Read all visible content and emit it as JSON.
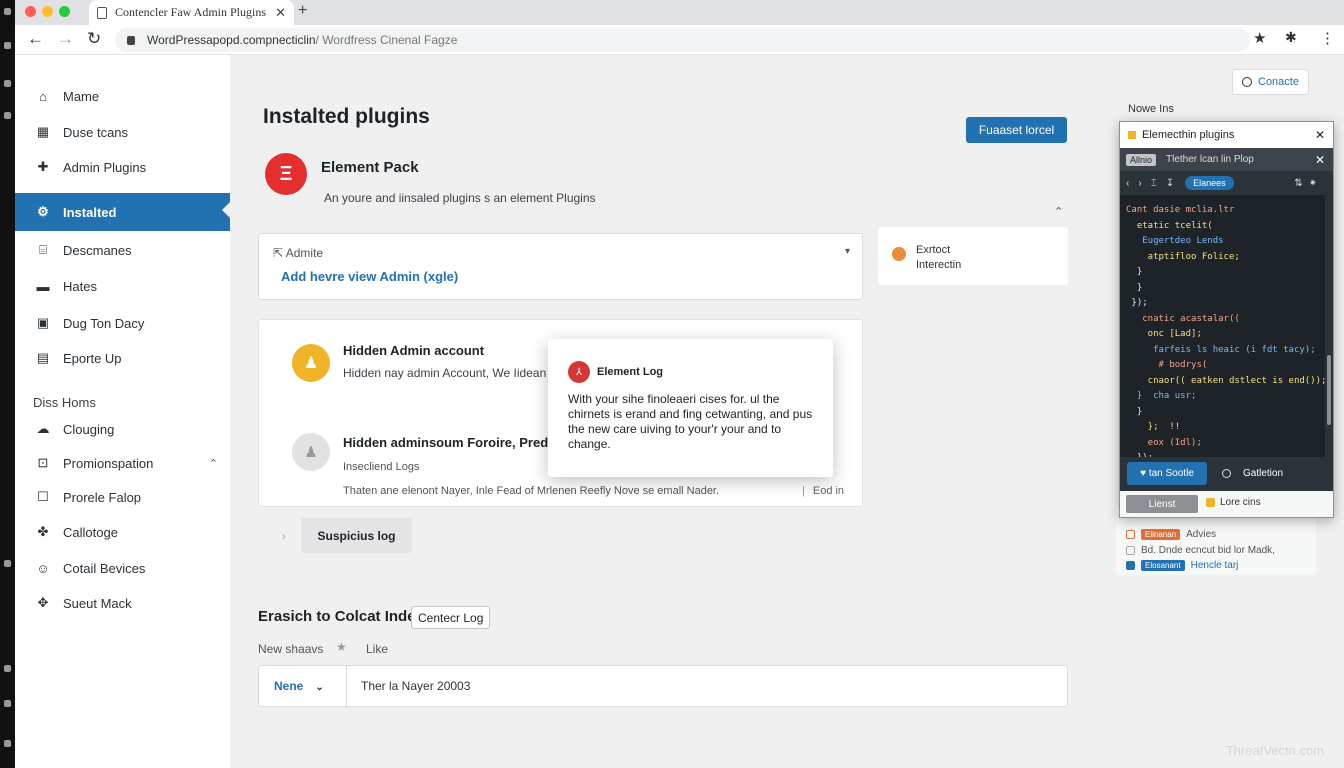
{
  "browser": {
    "tab_title": "Contencler Faw Admin Plugins",
    "tab_close": "✕",
    "new_tab": "+",
    "url_main": "WordPressapopd.compnecticlin",
    "url_rest": " / Wordfress Cinenal Fagze",
    "colors": {
      "tab_bar": "#dfe1e5",
      "traffic_red": "#ff5f57",
      "traffic_yellow": "#febc2e",
      "traffic_green": "#28c840"
    }
  },
  "sidebar": {
    "items": [
      {
        "label": "Mame",
        "icon": "home-icon"
      },
      {
        "label": "Duse tcans",
        "icon": "building-icon"
      },
      {
        "label": "Admin Plugins",
        "icon": "plugin-icon"
      },
      {
        "label": "Instalted",
        "icon": "gear-icon",
        "active": true
      },
      {
        "label": "Descmanes",
        "icon": "document-icon"
      },
      {
        "label": "Hates",
        "icon": "folder-icon"
      },
      {
        "label": "Dug Ton Dacy",
        "icon": "calendar-icon"
      },
      {
        "label": "Eporte Up",
        "icon": "export-icon"
      }
    ],
    "heading": "Diss Homs",
    "items2": [
      {
        "label": "Clouging",
        "icon": "cloud-icon"
      },
      {
        "label": "Promionspation",
        "icon": "promotion-icon",
        "expand": "⌃"
      },
      {
        "label": "Prorele Falop",
        "icon": "box-icon"
      },
      {
        "label": "Callotoge",
        "icon": "puzzle-icon"
      },
      {
        "label": "Cotail Bevices",
        "icon": "smile-icon"
      },
      {
        "label": "Sueut Mack",
        "icon": "pin-icon"
      }
    ],
    "accent": "#2271b1"
  },
  "main": {
    "title": "Instalted plugins",
    "primary_button": "Fuaaset lorcel",
    "plugin": {
      "logo_glyph": "Ξ",
      "name": "Element Pack",
      "description": "An youre and iinsaled plugins s an element Plugins"
    },
    "collapse": "⌃",
    "admin_card": {
      "label": "Admite",
      "link": "Add hevre view Admin (xgle)",
      "dropdown": "▾"
    },
    "extract_card": {
      "line1": "Exrtoct",
      "line2": "Interectin"
    },
    "account": {
      "title": "Hidden Admin account",
      "description": "Hidden nay admin Account,  We Iidean",
      "title2": "Hidden adminsoum Foroire, Predic",
      "sub2": "Insecliend Logs",
      "line2": "Thaten ane elenont Nayer, Inle Fead of Mrlenen Reefly Nove se emall Nader.",
      "extra2": "Eod in"
    },
    "suspicious": {
      "chevron": "›",
      "button": "Suspicius log"
    },
    "section2": {
      "title": "Erasich to Colcat Inde",
      "button": "Centecr Log",
      "hint": "New shaavs",
      "star": "★",
      "like": "Like"
    },
    "filter": {
      "select": "Nene",
      "chevron": "⌄",
      "value": "Ther la Nayer 20003"
    }
  },
  "dialog": {
    "icon_glyph": "⅄",
    "title": "Element Log",
    "body": "With your sihe finoleaeri cises for. ul the chirnets is erand and fing cetwanting, and pus the new care uiving to your'r your and to change."
  },
  "right_panel": {
    "contact_button": "Conacte",
    "note_label": "Nowe Ins",
    "log_rows": [
      {
        "badge": "Elinanan",
        "text": "Advies",
        "color": "#e0703a"
      },
      {
        "badge": "",
        "text": "Bd. Dnde ecncut bid lor Madk,",
        "color": ""
      },
      {
        "badge": "Elosanant",
        "text": "Hencle tarj",
        "color": "#2271b1"
      }
    ]
  },
  "code_window": {
    "title": "Elemecthin plugins",
    "close": "✕",
    "tab_chip": "Allnio",
    "tab_label": "Tlether lcan lin Plop",
    "toolbar_left": [
      "‹",
      "›",
      "⌶",
      "↧"
    ],
    "toolbar_pill": "Elanees",
    "toolbar_right": "⇅⁕",
    "code_lines": [
      "Cant dasie mclia.ltr",
      "  etatic tcelit(",
      "   Eugertdeo Lends",
      "    atptifloo Folice;",
      "  }",
      "  }",
      " });",
      "   cnatic acastalar((",
      "    onc [Lad];",
      "     farfeis ls heaic (i fdt tacy);",
      "      # bodrys(",
      "    cnaor(( eatken dstlect is end());",
      "  }  cha usr;",
      "  }",
      "    };  !!",
      "    eox (Idl);",
      "  });"
    ],
    "save": "tan Sootle",
    "cancel": "Gatletion",
    "footer_button": "Lienst",
    "footer_label": "Lore cins"
  },
  "watermark": "ThreatVectn.com"
}
